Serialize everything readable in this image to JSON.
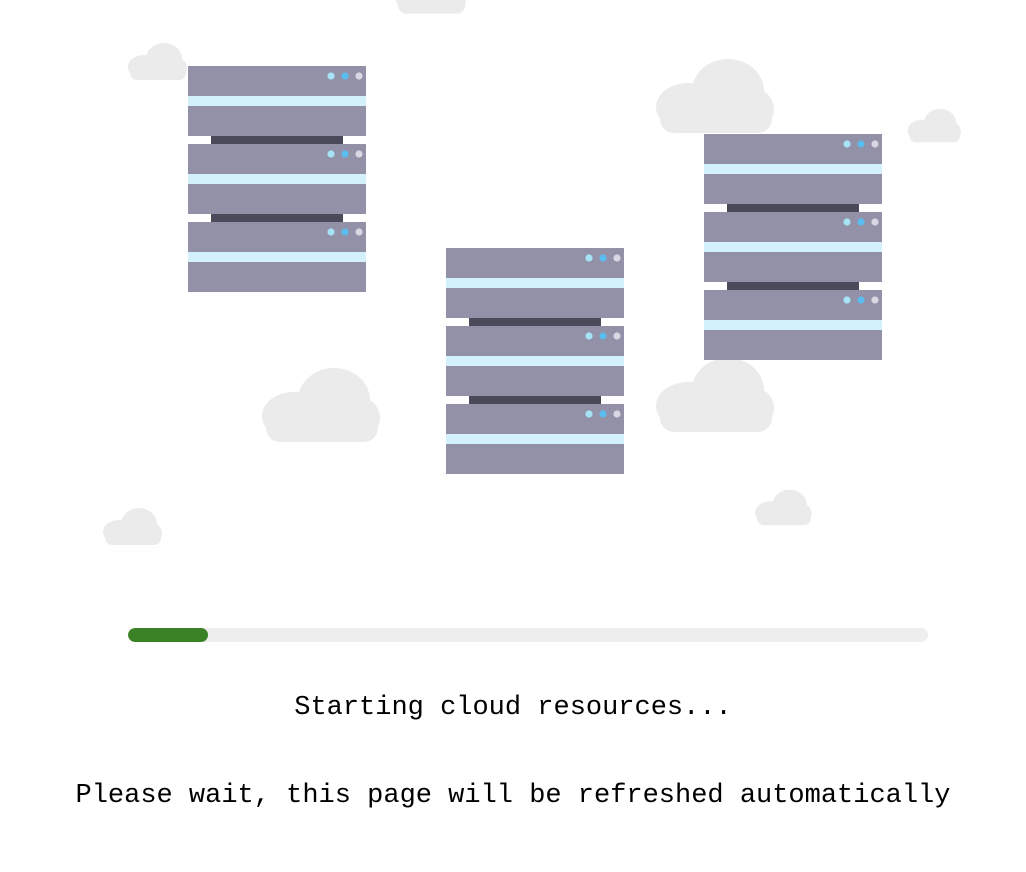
{
  "loader": {
    "status_message": "Starting cloud resources...",
    "wait_message": "Please wait, this page will be refreshed automatically",
    "progress_fraction": 0.1
  },
  "colors": {
    "progress_fill": "#3b8227",
    "progress_track": "#eeeeee",
    "server_body": "#9291a7",
    "server_stripe": "#d2f1fa",
    "server_connector": "#4a4a5a",
    "cloud": "#ebebeb",
    "led_light_blue": "#a5e3f5",
    "led_blue": "#5bbcef",
    "led_gray": "#d9d7e3"
  },
  "illustration": {
    "icons": [
      "server-rack-icon",
      "cloud-icon"
    ]
  }
}
